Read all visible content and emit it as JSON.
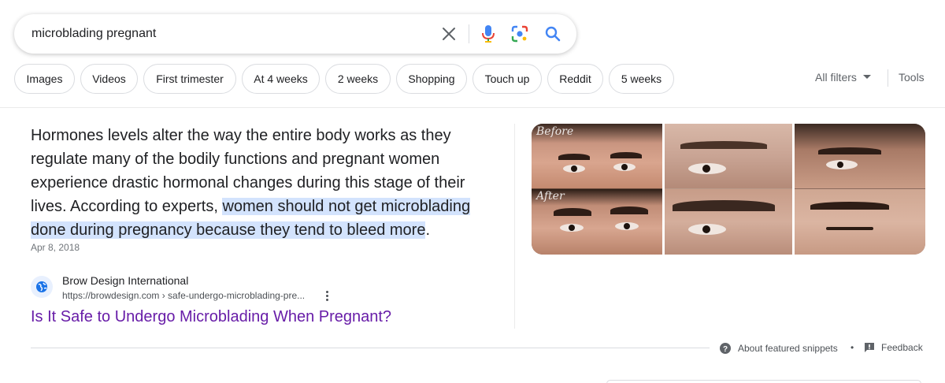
{
  "search": {
    "query": "microblading pregnant",
    "icons": [
      "close-icon",
      "microphone-icon",
      "lens-icon",
      "search-icon"
    ]
  },
  "chips": [
    "Images",
    "Videos",
    "First trimester",
    "At 4 weeks",
    "2 weeks",
    "Shopping",
    "Touch up",
    "Reddit",
    "5 weeks"
  ],
  "filters": {
    "all_filters": "All filters",
    "tools": "Tools"
  },
  "snippet": {
    "text_before": "Hormones levels alter the way the entire body works as they regulate many of the bodily functions and pregnant women experience drastic hormonal changes during this stage of their lives. According to experts, ",
    "text_highlight": "women should not get microblading done during pregnancy because they tend to bleed more",
    "text_after": ".",
    "date": "Apr 8, 2018"
  },
  "source": {
    "site_name": "Brow Design International",
    "url": "https://browdesign.com › safe-undergo-microblading-pre...",
    "title": "Is It Safe to Undergo Microblading When Pregnant?"
  },
  "images": {
    "before_label": "Before",
    "after_label": "After"
  },
  "footer": {
    "about": "About featured snippets",
    "separator": "•",
    "feedback": "Feedback"
  },
  "colors": {
    "highlight": "#d3e3fd",
    "visited_link": "#681da8",
    "google_blue": "#4285f4",
    "google_red": "#ea4335",
    "google_yellow": "#fbbc04",
    "google_green": "#34a853"
  }
}
